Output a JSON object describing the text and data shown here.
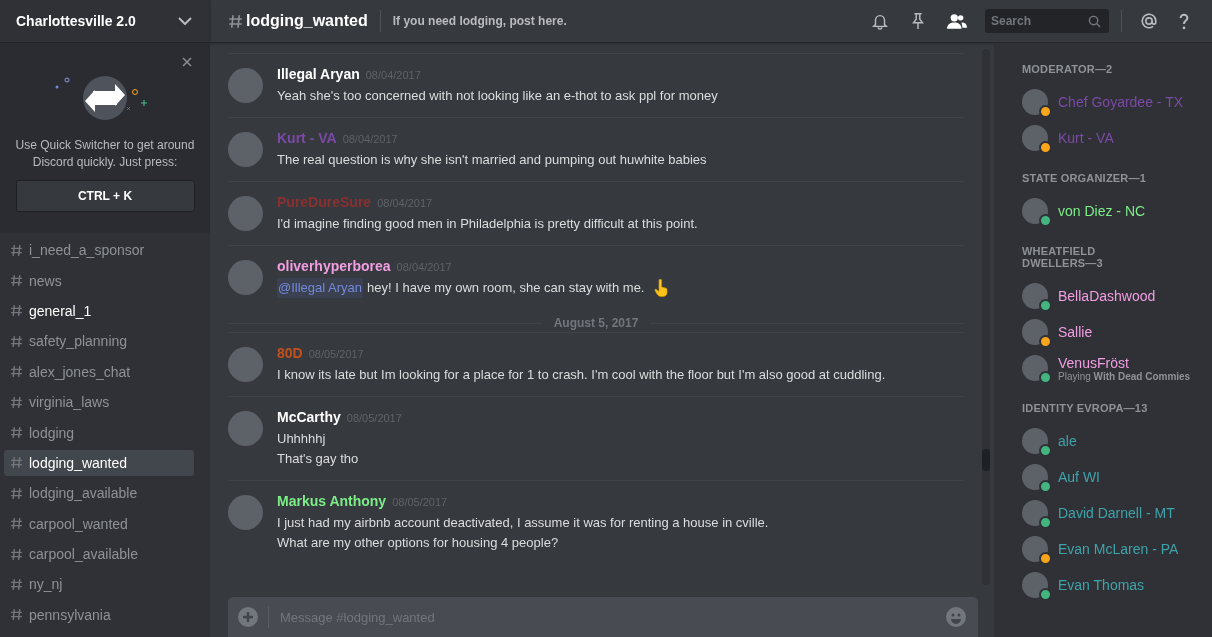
{
  "server": {
    "name": "Charlottesville 2.0"
  },
  "quick_switcher": {
    "text": "Use Quick Switcher to get around Discord quickly. Just press:",
    "shortcut": "CTRL + K"
  },
  "channels": [
    {
      "name": "i_need_a_sponsor",
      "unread": false,
      "selected": false
    },
    {
      "name": "news",
      "unread": false,
      "selected": false
    },
    {
      "name": "general_1",
      "unread": true,
      "selected": false
    },
    {
      "name": "safety_planning",
      "unread": false,
      "selected": false
    },
    {
      "name": "alex_jones_chat",
      "unread": false,
      "selected": false
    },
    {
      "name": "virginia_laws",
      "unread": false,
      "selected": false
    },
    {
      "name": "lodging",
      "unread": false,
      "selected": false
    },
    {
      "name": "lodging_wanted",
      "unread": false,
      "selected": true
    },
    {
      "name": "lodging_available",
      "unread": false,
      "selected": false
    },
    {
      "name": "carpool_wanted",
      "unread": false,
      "selected": false
    },
    {
      "name": "carpool_available",
      "unread": false,
      "selected": false
    },
    {
      "name": "ny_nj",
      "unread": false,
      "selected": false
    },
    {
      "name": "pennsylvania",
      "unread": false,
      "selected": false
    }
  ],
  "header": {
    "channel": "lodging_wanted",
    "topic": "If you need lodging, post here.",
    "search_placeholder": "Search"
  },
  "messages": [
    {
      "kind": "message",
      "author": "Illegal Aryan",
      "color": "#ffffff",
      "time": "08/04/2017",
      "lines": [
        "Yeah she's too concerned with not looking like an e-thot to ask ppl for money"
      ]
    },
    {
      "kind": "message",
      "author": "Kurt - VA",
      "color": "#7b4aa6",
      "time": "08/04/2017",
      "lines": [
        "The real question is why she isn't married and pumping out huwhite babies"
      ]
    },
    {
      "kind": "message",
      "author": "PureDureSure",
      "color": "#8a3030",
      "time": "08/04/2017",
      "lines": [
        "I'd imagine finding good men in Philadelphia is pretty difficult at this point."
      ]
    },
    {
      "kind": "message",
      "author": "oliverhyperborea",
      "color": "#f29ee2",
      "time": "08/04/2017",
      "mention": "@Illegal Aryan",
      "emoji": true,
      "lines": [
        "hey! I have my own room, she can stay with me."
      ]
    },
    {
      "kind": "divider",
      "label": "August 5, 2017"
    },
    {
      "kind": "message",
      "author": "80D",
      "color": "#c4501c",
      "time": "08/05/2017",
      "lines": [
        "I know its late but Im looking for a place for 1 to crash. I'm cool with the floor but I'm also good at cuddling."
      ]
    },
    {
      "kind": "message",
      "author": "McCarthy",
      "color": "#ffffff",
      "time": "08/05/2017",
      "lines": [
        "Uhhhhhj",
        "That's gay tho"
      ]
    },
    {
      "kind": "message",
      "author": "Markus Anthony",
      "color": "#7ced87",
      "time": "08/05/2017",
      "lines": [
        "I just had my airbnb account deactivated, I assume it was for renting a house in cville.",
        "What are my other options for housing 4 people?"
      ]
    }
  ],
  "composer": {
    "placeholder": "Message #lodging_wanted"
  },
  "member_groups": [
    {
      "title": "MODERATOR—2",
      "members": [
        {
          "name": "Chef Goyardee - TX",
          "color": "#7b4aa6",
          "idle": true
        },
        {
          "name": "Kurt - VA",
          "color": "#7b4aa6",
          "idle": true
        }
      ]
    },
    {
      "title": "STATE ORGANIZER—1",
      "members": [
        {
          "name": "von Diez - NC",
          "color": "#7ced87",
          "idle": false
        }
      ]
    },
    {
      "title": "WHEATFIELD DWELLERS—3",
      "members": [
        {
          "name": "BellaDashwood",
          "color": "#f29ee2",
          "idle": false
        },
        {
          "name": "Sallie",
          "color": "#f29ee2",
          "idle": true
        },
        {
          "name": "VenusFröst",
          "color": "#f29ee2",
          "idle": false,
          "activity": "Playing **With Dead Commies**"
        }
      ]
    },
    {
      "title": "IDENTITY EVROPA—13",
      "members": [
        {
          "name": "ale",
          "color": "#3fa3aa",
          "idle": false
        },
        {
          "name": "Auf WI",
          "color": "#3fa3aa",
          "idle": false
        },
        {
          "name": "David Darnell - MT",
          "color": "#3fa3aa",
          "idle": false
        },
        {
          "name": "Evan McLaren - PA",
          "color": "#3fa3aa",
          "idle": true
        },
        {
          "name": "Evan Thomas",
          "color": "#3fa3aa",
          "idle": false
        }
      ]
    }
  ]
}
